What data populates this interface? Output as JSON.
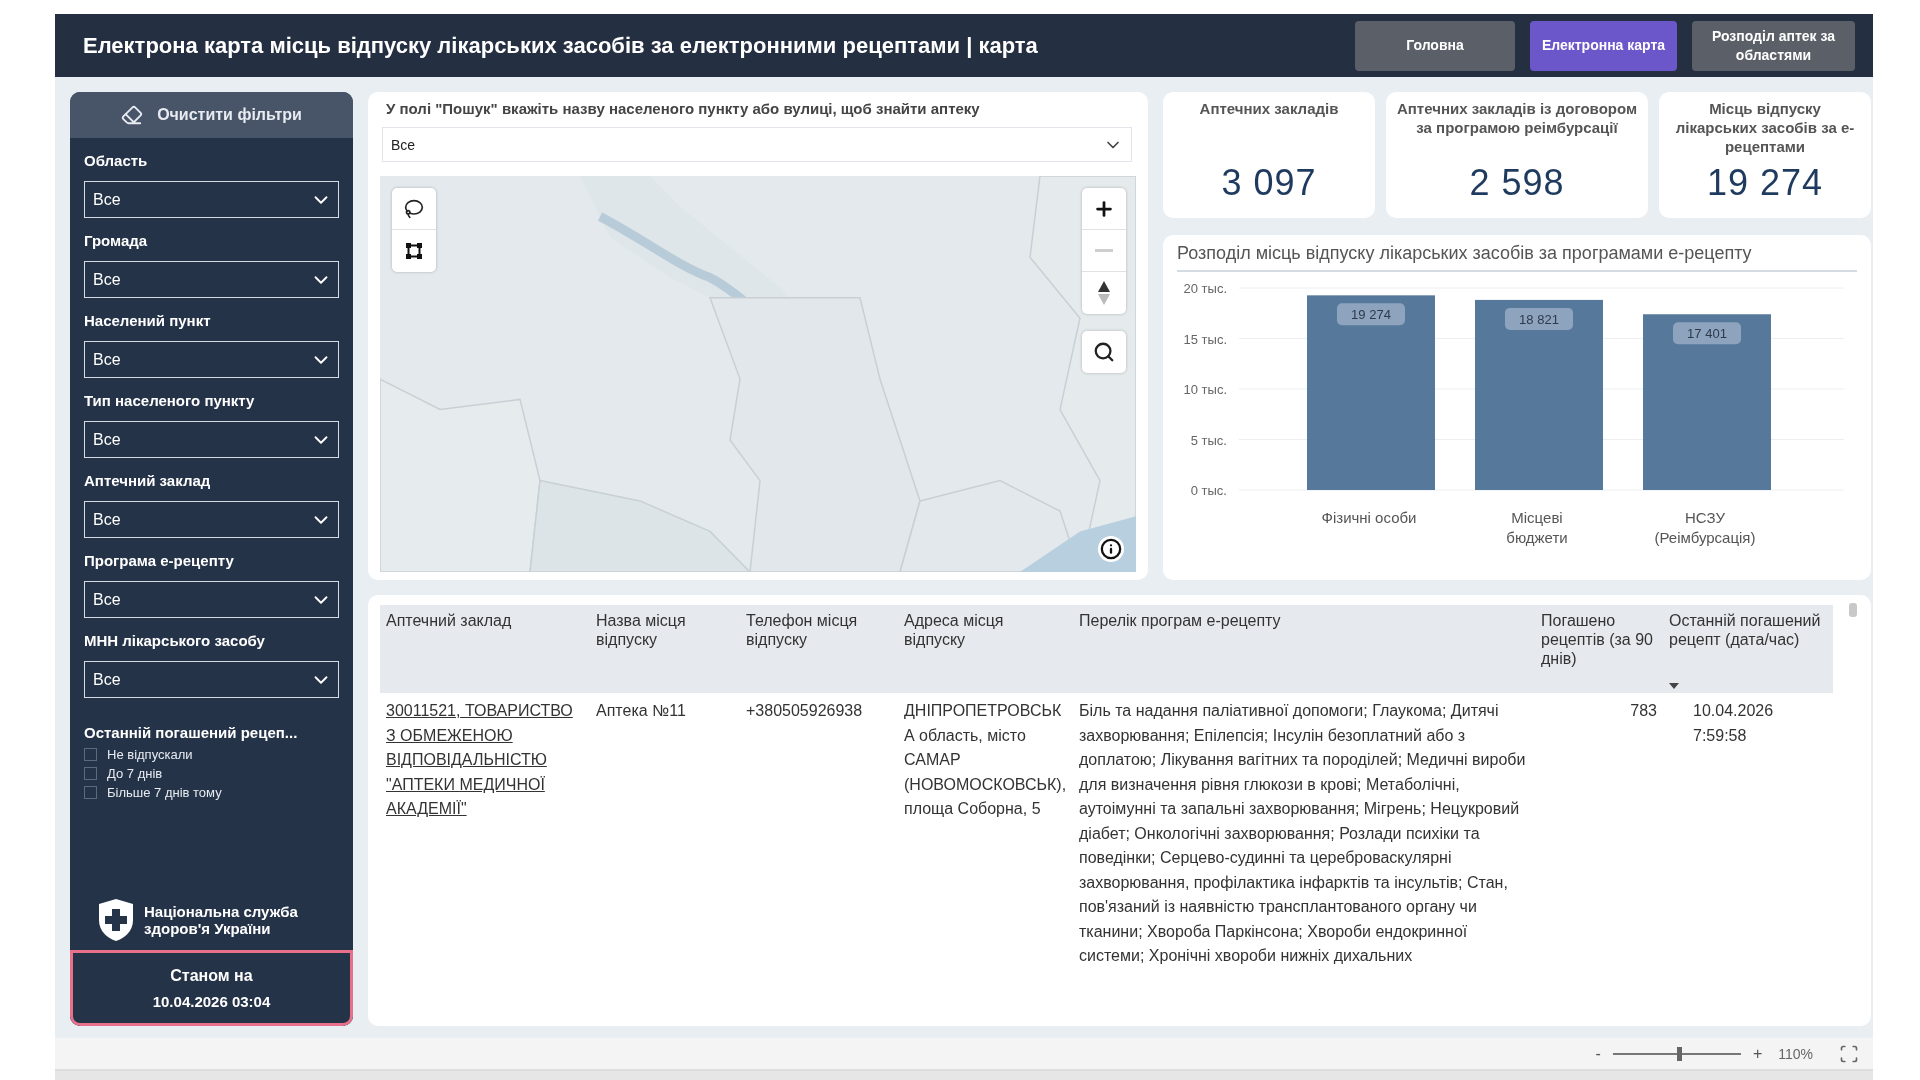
{
  "header": {
    "title": "Електрона карта місць відпуску лікарських засобів за електронними рецептами | карта",
    "nav": [
      {
        "label": "Головна",
        "selected": false
      },
      {
        "label": "Електронна карта",
        "selected": true
      },
      {
        "label": "Розподіл аптек за областями",
        "selected": false
      }
    ]
  },
  "sidebar": {
    "clear_button": "Очистити фільтри",
    "filters": [
      {
        "label": "Область",
        "value": "Все"
      },
      {
        "label": "Громада",
        "value": "Все"
      },
      {
        "label": "Населений пункт",
        "value": "Все"
      },
      {
        "label": "Тип населеного пункту",
        "value": "Все"
      },
      {
        "label": "Аптечний заклад",
        "value": "Все"
      },
      {
        "label": "Програма е-рецепту",
        "value": "Все"
      },
      {
        "label": "МНН лікарського засобу",
        "value": "Все"
      }
    ],
    "checkbox_group": {
      "title": "Останній погашений рецеп...",
      "options": [
        {
          "label": "Не відпускали",
          "checked": false
        },
        {
          "label": "До 7 днів",
          "checked": false
        },
        {
          "label": "Більше 7 днів тому",
          "checked": false
        }
      ]
    },
    "org": "Національна служба здоров'я України",
    "as_of": {
      "label": "Станом на",
      "value": "10.04.2026 03:04"
    }
  },
  "map_panel": {
    "hint": "У полі \"Пошук\" вкажіть назву населеного пункту або вулиці, щоб знайти аптеку",
    "search": {
      "value": "Все"
    }
  },
  "cards": [
    {
      "label": "Аптечних закладів",
      "value": "3 097"
    },
    {
      "label": "Аптечних закладів із договором за програмою реімбурсації",
      "value": "2 598"
    },
    {
      "label": "Місць відпуску лікарських засобів за е-рецептами",
      "value": "19 274"
    }
  ],
  "chart": {
    "chart_data": {
      "type": "bar",
      "title": "Розподіл місць відпуску лікарських засобів за програмами е-рецепту",
      "categories": [
        "Фізичні особи",
        "Місцеві бюджети",
        "НСЗУ (Реімбурсація)"
      ],
      "values": [
        19.274,
        18.821,
        17.401
      ],
      "ylim": [
        0,
        20
      ],
      "yticks": [
        {
          "value": 0,
          "label": "0 тыс."
        },
        {
          "value": 5,
          "label": "5 тыс."
        },
        {
          "value": 10,
          "label": "10 тыс."
        },
        {
          "value": 15,
          "label": "15 тыс."
        },
        {
          "value": 20,
          "label": "20 тыс."
        }
      ],
      "grid": true
    },
    "bar_labels": [
      "19 274",
      "18 821",
      "17 401"
    ]
  },
  "table": {
    "columns": [
      {
        "label": "Аптечний заклад",
        "sorted": false
      },
      {
        "label": "Назва місця відпуску",
        "sorted": false
      },
      {
        "label": "Телефон місця відпуску",
        "sorted": false
      },
      {
        "label": "Адреса місця відпуску",
        "sorted": false
      },
      {
        "label": "Перелік програм е-рецепту",
        "sorted": false
      },
      {
        "label": "Погашено рецептів (за 90 днів)",
        "sorted": false
      },
      {
        "label": "Останній погашений рецепт (дата/час)",
        "sorted": true
      }
    ],
    "rows": [
      {
        "cells": [
          {
            "kind": "link",
            "text": "30011521, ТОВАРИСТВО З ОБМЕЖЕНОЮ ВІДПОВІДАЛЬНІСТЮ \"АПТЕКИ МЕДИЧНОЇ АКАДЕМІЇ\""
          },
          {
            "kind": "text",
            "text": "Аптека №11"
          },
          {
            "kind": "text",
            "text": "+380505926938"
          },
          {
            "kind": "text",
            "text": "ДНІПРОПЕТРОВСЬКА область, місто САМАР (НОВОМОСКОВСЬК), площа Соборна, 5"
          },
          {
            "kind": "text",
            "text": "Біль та надання паліативної допомоги; Глаукома; Дитячі захворювання; Епілепсія; Інсулін безоплатний або з доплатою; Лікування вагітних та породілей; Медичні вироби для визначення рівня глюкози в крові; Метаболічні, аутоімунні та запальні захворювання; Мігрень; Нецукровий діабет; Онкологічні захворювання; Розлади психіки та поведінки; Серцево-судинні та цереброваскулярні захворювання, профілактика інфарктів та інсультів; Стан, пов'язаний із наявністю трансплантованого органу чи тканини; Хвороба Паркінсона; Хвороби ендокринної системи; Хронічні хвороби нижніх дихальних"
          },
          {
            "kind": "number",
            "text": "783"
          },
          {
            "kind": "date",
            "text": "10.04.2026 7:59:58"
          }
        ]
      }
    ]
  },
  "zoom": {
    "minus": "-",
    "plus": "+",
    "level": 0.52,
    "reading": "110%"
  }
}
